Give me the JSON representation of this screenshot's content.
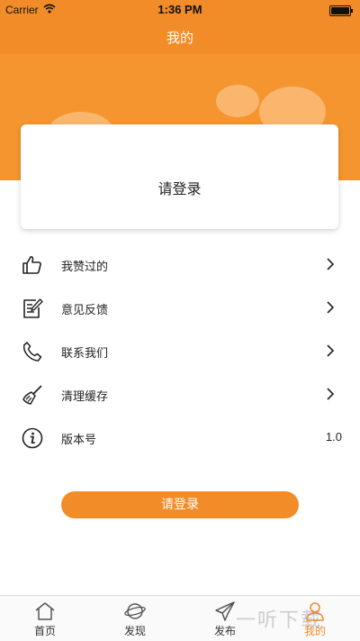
{
  "status_bar": {
    "carrier": "Carrier",
    "time": "1:36 PM"
  },
  "nav": {
    "title": "我的"
  },
  "card": {
    "login_text": "请登录"
  },
  "menu": [
    {
      "label": "我赞过的",
      "icon": "thumb-up-icon",
      "has_arrow": true
    },
    {
      "label": "意见反馈",
      "icon": "feedback-edit-icon",
      "has_arrow": true
    },
    {
      "label": "联系我们",
      "icon": "phone-icon",
      "has_arrow": true
    },
    {
      "label": "清理缓存",
      "icon": "broom-icon",
      "has_arrow": true
    },
    {
      "label": "版本号",
      "icon": "info-icon",
      "value": "1.0"
    }
  ],
  "login_button": {
    "label": "请登录"
  },
  "tabbar": {
    "items": [
      {
        "label": "首页",
        "icon": "home-icon"
      },
      {
        "label": "发现",
        "icon": "planet-icon"
      },
      {
        "label": "发布",
        "icon": "paper-plane-icon"
      },
      {
        "label": "我的",
        "icon": "user-icon",
        "active": true
      }
    ]
  },
  "watermark": {
    "text": "一听下载"
  },
  "colors": {
    "accent": "#f28c28",
    "banner": "#f4952f"
  }
}
